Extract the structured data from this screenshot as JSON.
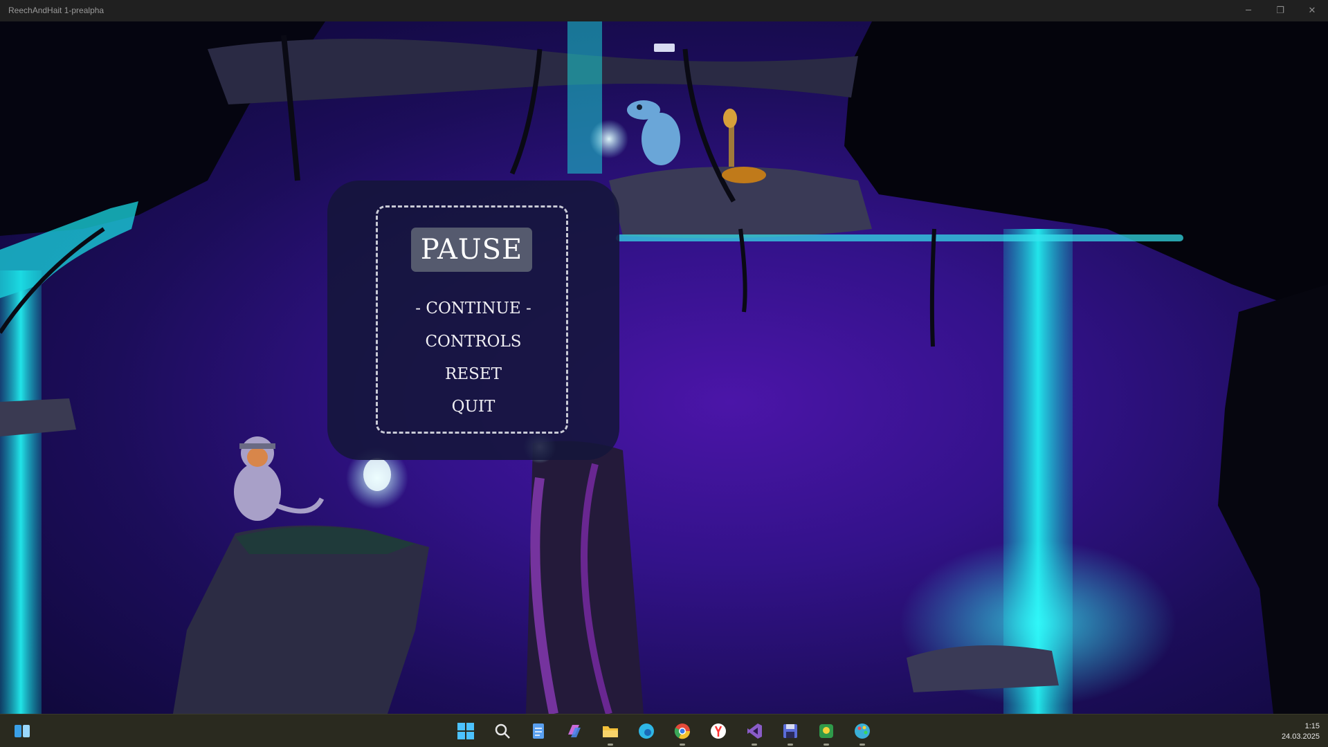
{
  "window": {
    "title": "ReechAndHait 1-prealpha",
    "minimize_glyph": "─",
    "maximize_glyph": "❐",
    "close_glyph": "✕"
  },
  "pause_menu": {
    "title": "PAUSE",
    "items": [
      "- CONTINUE -",
      "CONTROLS",
      "RESET",
      "QUIT"
    ],
    "selected_index": 0
  },
  "taskbar": {
    "icons": [
      {
        "name": "widgets-icon",
        "color": "#3aa0e8"
      },
      {
        "name": "windows-start-icon",
        "color": "#4cc2ff"
      },
      {
        "name": "search-icon",
        "color": "#e6e6e6"
      },
      {
        "name": "notepad-icon",
        "color": "#5aa0f0"
      },
      {
        "name": "copilot-icon",
        "color": "#c86bd8"
      },
      {
        "name": "file-explorer-icon",
        "color": "#f3c13a"
      },
      {
        "name": "edge-icon",
        "color": "#2fb7e6"
      },
      {
        "name": "chrome-icon",
        "color": "#e44a3a"
      },
      {
        "name": "yandex-browser-icon",
        "color": "#ff3333"
      },
      {
        "name": "visual-studio-icon",
        "color": "#8a5cc8"
      },
      {
        "name": "save-app-icon",
        "color": "#5a6cd8"
      },
      {
        "name": "green-app-icon",
        "color": "#2f9a4a"
      },
      {
        "name": "paint-icon",
        "color": "#3ab0d8"
      }
    ],
    "time": "1:15",
    "date": "24.03.2025"
  }
}
